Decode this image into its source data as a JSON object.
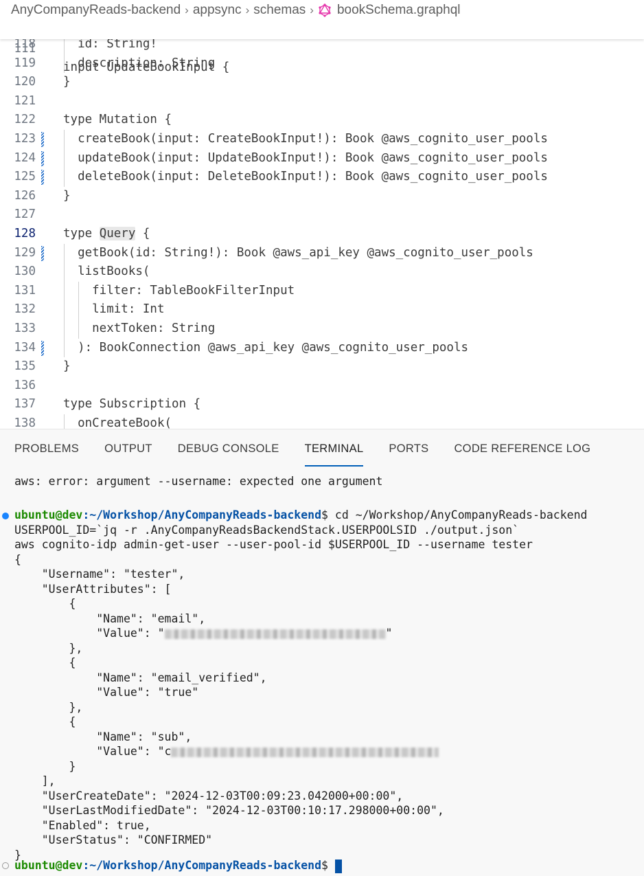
{
  "breadcrumb": {
    "items": [
      "AnyCompanyReads-backend",
      "appsync",
      "schemas"
    ],
    "file": "bookSchema.graphql",
    "file_icon": "graphql-icon",
    "separator": "›"
  },
  "editor": {
    "sticky_line": {
      "number": "111",
      "text": "input UpdateBookInput {"
    },
    "lines": [
      {
        "number": "118",
        "text": "  id: String!",
        "modified": false
      },
      {
        "number": "119",
        "text": "  description: String",
        "modified": false
      },
      {
        "number": "120",
        "text": "}",
        "modified": false
      },
      {
        "number": "121",
        "text": "",
        "modified": false
      },
      {
        "number": "122",
        "text": "type Mutation {",
        "modified": false
      },
      {
        "number": "123",
        "text": "  createBook(input: CreateBookInput!): Book @aws_cognito_user_pools",
        "modified": true
      },
      {
        "number": "124",
        "text": "  updateBook(input: UpdateBookInput!): Book @aws_cognito_user_pools",
        "modified": true
      },
      {
        "number": "125",
        "text": "  deleteBook(input: DeleteBookInput!): Book @aws_cognito_user_pools",
        "modified": true
      },
      {
        "number": "126",
        "text": "}",
        "modified": false
      },
      {
        "number": "127",
        "text": "",
        "modified": false
      },
      {
        "number": "128",
        "text": "type Query {",
        "modified": false,
        "active": true,
        "highlight": "Query"
      },
      {
        "number": "129",
        "text": "  getBook(id: String!): Book @aws_api_key @aws_cognito_user_pools",
        "modified": true
      },
      {
        "number": "130",
        "text": "  listBooks(",
        "modified": false
      },
      {
        "number": "131",
        "text": "    filter: TableBookFilterInput",
        "modified": false
      },
      {
        "number": "132",
        "text": "    limit: Int",
        "modified": false
      },
      {
        "number": "133",
        "text": "    nextToken: String",
        "modified": false
      },
      {
        "number": "134",
        "text": "  ): BookConnection @aws_api_key @aws_cognito_user_pools",
        "modified": true
      },
      {
        "number": "135",
        "text": "}",
        "modified": false
      },
      {
        "number": "136",
        "text": "",
        "modified": false
      },
      {
        "number": "137",
        "text": "type Subscription {",
        "modified": false
      },
      {
        "number": "138",
        "text": "  onCreateBook(",
        "modified": false
      }
    ]
  },
  "panel": {
    "tabs": [
      {
        "label": "PROBLEMS",
        "active": false
      },
      {
        "label": "OUTPUT",
        "active": false
      },
      {
        "label": "DEBUG CONSOLE",
        "active": false
      },
      {
        "label": "TERMINAL",
        "active": true
      },
      {
        "label": "PORTS",
        "active": false
      },
      {
        "label": "CODE REFERENCE LOG",
        "active": false
      }
    ]
  },
  "terminal": {
    "error_line": "aws: error: argument --username: expected one argument",
    "prompt_user": "ubuntu@dev",
    "prompt_path": ":~/Workshop/AnyCompanyReads-backend",
    "prompt_symbol": "$",
    "command1": " cd ~/Workshop/AnyCompanyReads-backend",
    "command2": "USERPOOL_ID=`jq -r .AnyCompanyReadsBackendStack.USERPOOLSID ./output.json`",
    "command3": "aws cognito-idp admin-get-user --user-pool-id $USERPOOL_ID --username tester",
    "output": [
      "{",
      "    \"Username\": \"tester\",",
      "    \"UserAttributes\": [",
      "        {",
      "            \"Name\": \"email\",",
      "            \"Value\": \"",
      "        },",
      "        {",
      "            \"Name\": \"email_verified\",",
      "            \"Value\": \"true\"",
      "        },",
      "        {",
      "            \"Name\": \"sub\",",
      "            \"Value\": \"c",
      "        }",
      "    ],",
      "    \"UserCreateDate\": \"2024-12-03T00:09:23.042000+00:00\",",
      "    \"UserLastModifiedDate\": \"2024-12-03T00:10:17.298000+00:00\",",
      "    \"Enabled\": true,",
      "    \"UserStatus\": \"CONFIRMED\"",
      "}"
    ],
    "redacted_email": "[redacted]",
    "redacted_sub": "[redacted]"
  }
}
